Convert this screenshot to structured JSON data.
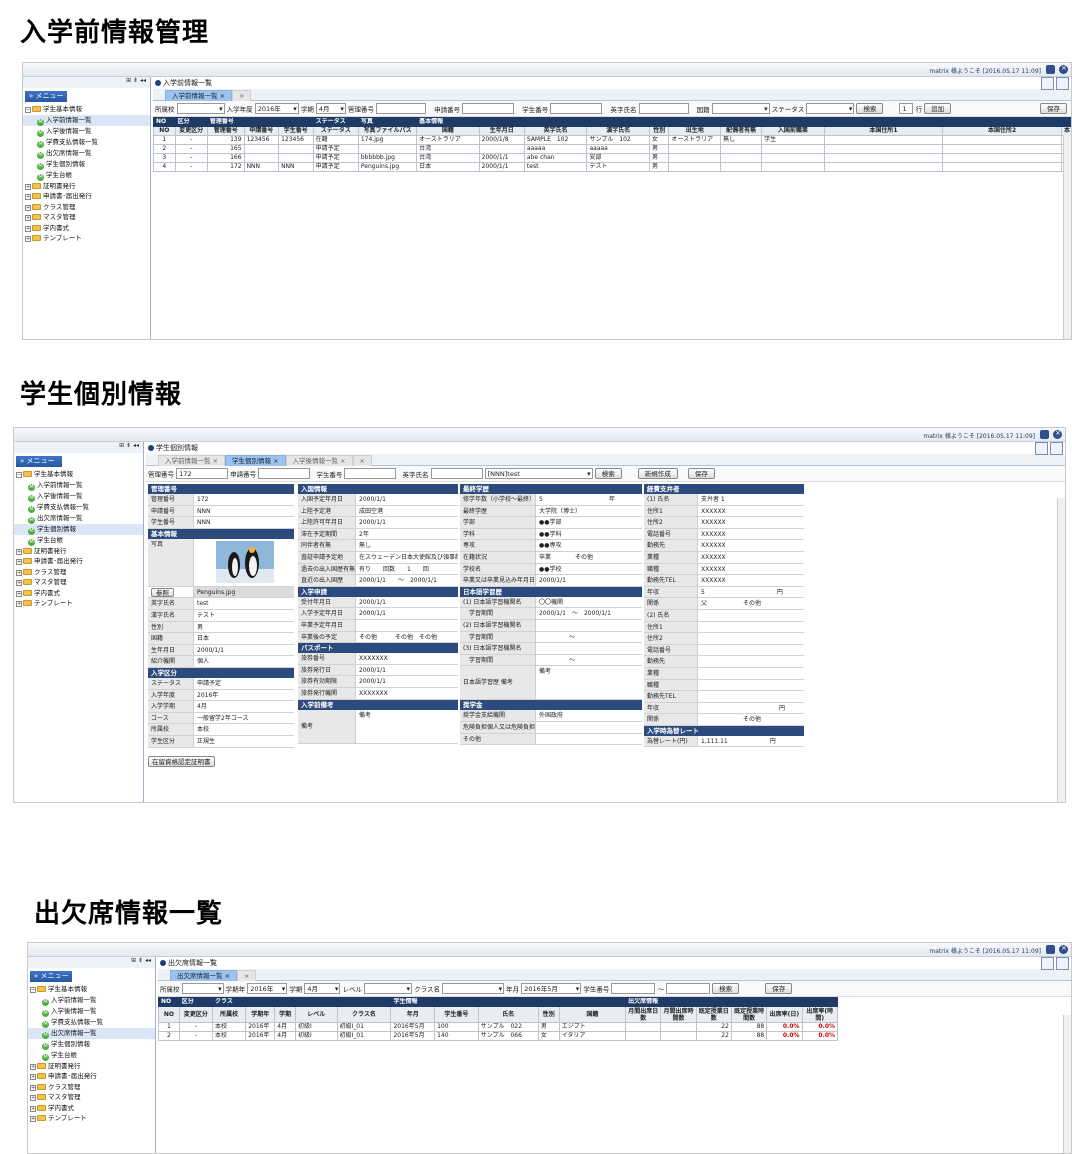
{
  "sections": {
    "s1": "入学前情報管理",
    "s2": "学生個別情報",
    "s3": "出欠席情報一覧"
  },
  "topbar": {
    "user": "matrix 様ようこそ [2016.05.17 11:09]"
  },
  "sidebar": {
    "tools": "⊞ ⇟ ◂◂",
    "menu": "» メニュー",
    "root": "学生基本情報",
    "items": [
      "入学前情報一覧",
      "入学後情報一覧",
      "学費支払情報一覧",
      "出欠席情報一覧",
      "学生個別情報",
      "学生台帳"
    ],
    "folders": [
      "証明書発行",
      "申請書･届出発行",
      "クラス管理",
      "マスタ管理",
      "学内書式",
      "テンプレート"
    ]
  },
  "p1": {
    "crumb": "入学前情報一覧",
    "tab": "入学前情報一覧 ×",
    "filters": {
      "school_label": "所属校",
      "year_label": "入学年度",
      "year": "2016年",
      "term_label": "学期",
      "term": "4月",
      "mgmt_label": "管理番号",
      "app_label": "申請番号",
      "stu_label": "学生番号",
      "en_label": "英字氏名",
      "nat_label": "国籍",
      "status_label": "ステータス",
      "search": "検索",
      "count": "1",
      "rows_label": "行",
      "add": "追加",
      "save": "保存"
    },
    "groups": [
      "NO",
      "区分",
      "管理番号",
      "ステータス",
      "写真",
      "基本情報"
    ],
    "headers": [
      "NO",
      "変更区分",
      "管理番号",
      "申請番号",
      "学生番号",
      "ステータス",
      "写真ファイルパス",
      "国籍",
      "生年月日",
      "英字氏名",
      "漢字氏名",
      "性別",
      "出生地",
      "配偶者有無",
      "入国前職業",
      "本国住所1",
      "本国住所2",
      "本"
    ],
    "rows": [
      [
        "1",
        "-",
        "139",
        "123456",
        "123456",
        "在籍",
        "174.jpg",
        "オーストラリア",
        "2000/1/8",
        "SAMPLE　102",
        "サンプル　102",
        "女",
        "オーストラリア",
        "無し",
        "学生",
        "",
        "",
        ""
      ],
      [
        "2",
        "-",
        "165",
        "",
        "",
        "申請予定",
        "",
        "台湾",
        "",
        "aaaaa",
        "aaaaa",
        "男",
        "",
        "",
        "",
        "",
        "",
        ""
      ],
      [
        "3",
        "-",
        "166",
        "",
        "",
        "申請予定",
        "bbbbbb.jpg",
        "台湾",
        "2000/1/1",
        "abe chan",
        "安部",
        "男",
        "",
        "",
        "",
        "",
        "",
        ""
      ],
      [
        "4",
        "-",
        "172",
        "NNN",
        "NNN",
        "申請予定",
        "Penguins.jpg",
        "日本",
        "2000/1/1",
        "test",
        "テスト",
        "男",
        "",
        "",
        "",
        "",
        "",
        ""
      ]
    ]
  },
  "p2": {
    "crumb": "学生個別情報",
    "tabs": [
      "入学前情報一覧 ×",
      "学生個別情報 ×",
      "入学後情報一覧 ×",
      "×"
    ],
    "filters": {
      "mgmt_label": "管理番号",
      "mgmt": "172",
      "app_label": "申請番号",
      "stu_label": "学生番号",
      "en_label": "英字氏名",
      "sel": "[NNN]test",
      "search": "検索",
      "new": "新規作成",
      "save": "保存"
    },
    "col1": {
      "h1": "管理番号",
      "r1": [
        [
          "管理番号",
          "172"
        ],
        [
          "申請番号",
          "NNN"
        ],
        [
          "学生番号",
          "NNN"
        ]
      ],
      "h2": "基本情報",
      "photo_label": "写真",
      "ref": "参照",
      "photo_file": "Penguins.jpg",
      "r2": [
        [
          "英字氏名",
          "test"
        ],
        [
          "漢字氏名",
          "テスト"
        ],
        [
          "性別",
          "男"
        ],
        [
          "国籍",
          "日本"
        ],
        [
          "生年月日",
          "2000/1/1"
        ],
        [
          "紹介機関",
          "個人"
        ]
      ],
      "h3": "入学区分",
      "r3": [
        [
          "ステータス",
          "申請予定"
        ],
        [
          "入学年度",
          "2016年"
        ],
        [
          "入学学期",
          "4月"
        ],
        [
          "コース",
          "一般留学2年コース"
        ],
        [
          "所属校",
          "本校"
        ],
        [
          "学生区分",
          "正規生"
        ]
      ],
      "cert": "在留資格認定証明書"
    },
    "col2": {
      "h1": "入国情報",
      "r1": [
        [
          "入国予定年月日",
          "2000/1/1"
        ],
        [
          "上陸予定港",
          "成田空港"
        ],
        [
          "上陸許可年月日",
          "2000/1/1"
        ],
        [
          "滞在予定期間",
          "2年"
        ],
        [
          "同伴者有無",
          "無し"
        ],
        [
          "査証申請予定地",
          "在スウェーデン日本大使館及び領事館"
        ],
        [
          "過去の出入国歴有無",
          "有り　　回数　　1　　回"
        ],
        [
          "直近の出入国歴",
          "2000/1/1　　～　2000/1/1"
        ]
      ],
      "h2": "入学申請",
      "r2": [
        [
          "受付年月日",
          "2000/1/1"
        ],
        [
          "入学予定年月日",
          "2000/1/1"
        ],
        [
          "卒業予定年月日",
          ""
        ],
        [
          "卒業後の予定",
          "その他　　　その他　その他"
        ]
      ],
      "h3": "パスポート",
      "r3": [
        [
          "旅券番号",
          "XXXXXXX"
        ],
        [
          "旅券発行日",
          "2000/1/1"
        ],
        [
          "旅券有効期限",
          "2000/1/1"
        ],
        [
          "旅券発行機関",
          "XXXXXXX"
        ]
      ],
      "h4": "入学前備考",
      "note_label": "備考",
      "note": "備考"
    },
    "col3": {
      "h1": "最終学歴",
      "r1": [
        [
          "修学年数（小学校～最終）",
          "5　　　　　　　　　　　年"
        ],
        [
          "最終学歴",
          "大学院（博士）"
        ],
        [
          "学部",
          "●●学部"
        ],
        [
          "学科",
          "●●学科"
        ],
        [
          "専攻",
          "●●専攻"
        ],
        [
          "在籍状況",
          "卒業　　　　その他"
        ],
        [
          "学校名",
          "●●学校"
        ],
        [
          "卒業又は卒業見込み年月日",
          "2000/1/1"
        ]
      ],
      "h2": "日本語学習歴",
      "r2": [
        [
          "(1) 日本語学習機関名",
          "〇〇機関"
        ],
        [
          "　学習期間",
          "2000/1/1　～　2000/1/1"
        ],
        [
          "(2) 日本語学習機関名",
          ""
        ],
        [
          "　学習期間",
          "　　　　　～"
        ],
        [
          "(3) 日本語学習機関名",
          ""
        ],
        [
          "　学習期間",
          "　　　　　～"
        ]
      ],
      "jp_note_label": "日本語学習歴 備考",
      "jp_note": "備考",
      "h3": "奨学金",
      "r3": [
        [
          "奨学金支給機関",
          "外国政府"
        ],
        [
          "危険負担個人又は危険負担個人",
          ""
        ],
        [
          "その他",
          ""
        ]
      ]
    },
    "col4": {
      "h1": "経費支弁者",
      "r1": [
        [
          "(1) 氏名",
          "支弁者 1"
        ],
        [
          "住所1",
          "XXXXXX"
        ],
        [
          "住所2",
          "XXXXXX"
        ],
        [
          "電話番号",
          "XXXXXX"
        ],
        [
          "勤務先",
          "XXXXXX"
        ],
        [
          "業種",
          "XXXXXX"
        ],
        [
          "職種",
          "XXXXXX"
        ],
        [
          "勤務先TEL",
          "XXXXXX"
        ],
        [
          "年収",
          "5　　　　　　　　　　　　円"
        ],
        [
          "関係",
          "父　　　　　　その他"
        ],
        [
          "(2) 氏名",
          ""
        ],
        [
          "住所1",
          ""
        ],
        [
          "住所2",
          ""
        ],
        [
          "電話番号",
          ""
        ],
        [
          "勤務先",
          ""
        ],
        [
          "業種",
          ""
        ],
        [
          "職種",
          ""
        ],
        [
          "勤務先TEL",
          ""
        ],
        [
          "年収",
          "　　　　　　　　　　　　　円"
        ],
        [
          "関係",
          "　　　　　　　その他"
        ]
      ],
      "h2": "入学時為替レート",
      "rate_label": "為替レート(円)",
      "rate": "1,111.11　　　　　　　円"
    }
  },
  "p3": {
    "crumb": "出欠席情報一覧",
    "tab": "出欠席情報一覧 ×",
    "filters": {
      "school_label": "所属校",
      "year_label": "学期年",
      "year": "2016年",
      "term_label": "学期",
      "term": "4月",
      "level_label": "レベル",
      "class_label": "クラス名",
      "ym_label": "年月",
      "ym": "2016年5月",
      "stu_label": "学生番号",
      "tilde": "～",
      "search": "検索",
      "save": "保存"
    },
    "groups": [
      "NO",
      "区分",
      "クラス",
      "学生情報",
      "出欠席情報"
    ],
    "headers": [
      "NO",
      "変更区分",
      "所属校",
      "学期年",
      "学期",
      "レベル",
      "クラス名",
      "年月",
      "学生番号",
      "氏名",
      "性別",
      "国籍",
      "月間出席日数",
      "月間出席時間数",
      "既定授業日数",
      "既定授業時間数",
      "出席率(日)",
      "出席率(時間)"
    ],
    "rows": [
      [
        "1",
        "-",
        "本校",
        "2016年",
        "4月",
        "初級Ⅰ",
        "初級Ⅰ_01",
        "2016年5月",
        "100",
        "サンプル　022",
        "男",
        "エジプト",
        "",
        "",
        "22",
        "88",
        "0.0%",
        "0.0%"
      ],
      [
        "2",
        "-",
        "本校",
        "2016年",
        "4月",
        "初級Ⅰ",
        "初級Ⅰ_01",
        "2016年5月",
        "140",
        "サンプル　066",
        "女",
        "イタリア",
        "",
        "",
        "22",
        "88",
        "0.0%",
        "0.0%"
      ]
    ]
  }
}
